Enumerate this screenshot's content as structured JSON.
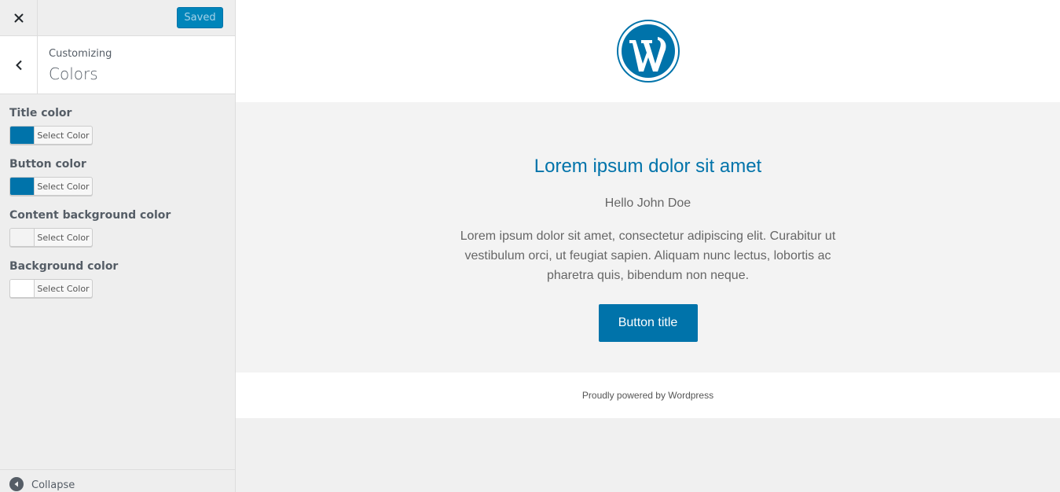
{
  "sidebar": {
    "save_label": "Saved",
    "section": {
      "breadcrumb": "Customizing",
      "title": "Colors"
    },
    "controls": [
      {
        "label": "Title color",
        "button": "Select Color",
        "swatch": "#0073aa"
      },
      {
        "label": "Button color",
        "button": "Select Color",
        "swatch": "#0073aa"
      },
      {
        "label": "Content background color",
        "button": "Select Color",
        "swatch": "#f3f3f3"
      },
      {
        "label": "Background color",
        "button": "Select Color",
        "swatch": "#ffffff"
      }
    ],
    "collapse_label": "Collapse"
  },
  "preview": {
    "title": "Lorem ipsum dolor sit amet",
    "greeting": "Hello John Doe",
    "body": "Lorem ipsum dolor sit amet, consectetur adipiscing elit. Curabitur ut vestibulum orci, ut feugiat sapien. Aliquam nunc lectus, lobortis ac pharetra quis, bibendum non neque.",
    "button": "Button title",
    "footer": "Proudly powered by Wordpress"
  },
  "colors": {
    "accent": "#0073aa",
    "save_button": "#0085ba"
  },
  "icons": {
    "close": "close-icon",
    "back": "chevron-left-icon",
    "logo": "wordpress-logo-icon",
    "collapse": "collapse-arrow-icon"
  }
}
